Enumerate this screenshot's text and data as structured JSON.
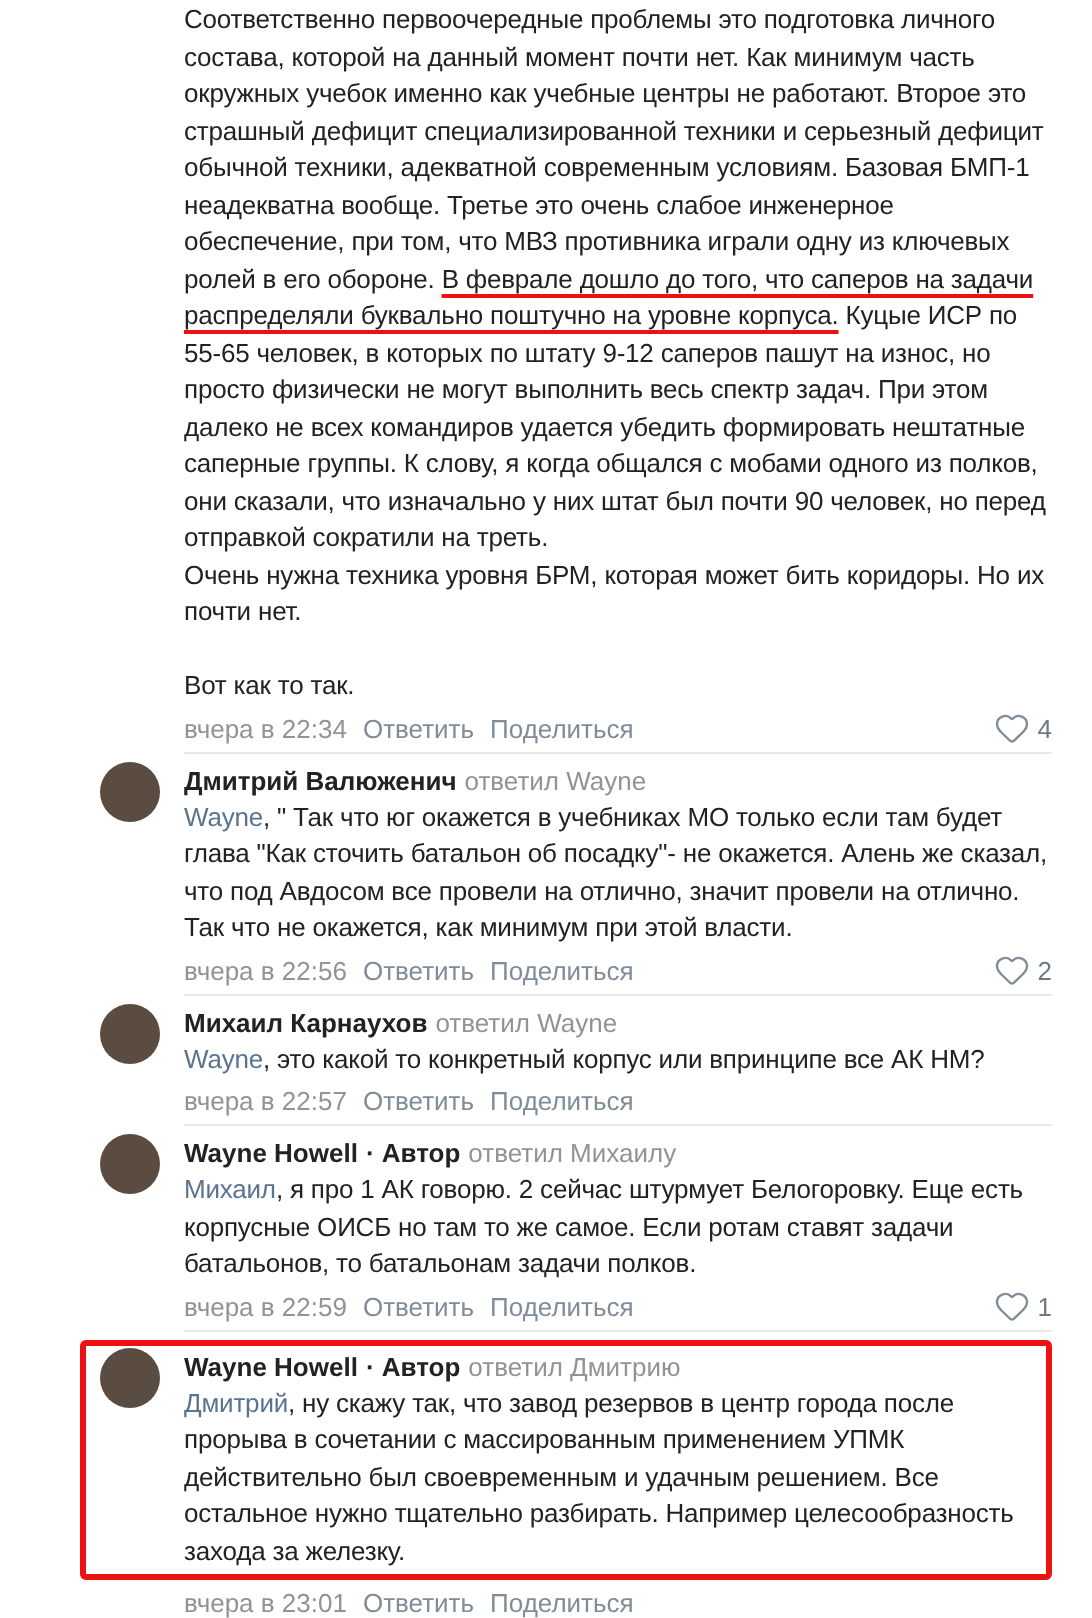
{
  "comments": [
    {
      "paragraphs": [
        {
          "segments": [
            {
              "text": "Соответственно первоочередные проблемы это подготовка личного состава, которой на данный момент почти нет. Как минимум часть окружных учебок именно как учебные центры не работают. Второе это страшный дефицит специализированной техники и серьезный дефицит обычной техники, адекватной современным условиям. Базовая БМП-1 неадекватна вообще. Третье это очень слабое инженерное обеспечение, при том, что МВЗ противника играли одну из ключевых ролей в его обороне. ",
              "underlined": false
            },
            {
              "text": "В феврале дошло до того, что саперов на задачи распределяли буквально поштучно на уровне корпуса.",
              "underlined": true
            },
            {
              "text": " Куцые ИСР по 55-65 человек, в которых по штату 9-12 саперов пашут на износ, но просто физически не могут выполнить весь спектр задач. При этом далеко не всех командиров удается убедить формировать нештатные саперные группы. К слову, я когда общался с мобами одного из полков, они сказали, что изначально у них штат был почти 90 человек, но перед отправкой сократили на треть.",
              "underlined": false
            }
          ]
        },
        {
          "segments": [
            {
              "text": "Очень нужна техника уровня БРМ, которая может бить коридоры. Но их почти нет.",
              "underlined": false
            }
          ]
        },
        {
          "segments": [
            {
              "text": "Вот как то так.",
              "underlined": false
            }
          ]
        }
      ],
      "time": "вчера в 22:34",
      "reply": "Ответить",
      "share": "Поделиться",
      "likes": "4",
      "highlighted": false
    },
    {
      "author": "Дмитрий Валюженич",
      "reply_to": "ответил Wayne",
      "paragraphs": [
        {
          "mention": "Wayne",
          "segments": [
            {
              "text": ", \" Так что юг окажется в учебниках МО только если там будет глава \"Как сточить батальон об посадку\"- не окажется. Алень же сказал, что под Авдосом все провели на отлично, значит провели на отлично. Так что не окажется, как минимум при этой власти.",
              "underlined": false
            }
          ]
        }
      ],
      "time": "вчера в 22:56",
      "reply": "Ответить",
      "share": "Поделиться",
      "likes": "2",
      "highlighted": false
    },
    {
      "author": "Михаил Карнаухов",
      "reply_to": "ответил Wayne",
      "paragraphs": [
        {
          "mention": "Wayne",
          "segments": [
            {
              "text": ", это какой то конкретный корпус или впринципе все АК НМ?",
              "underlined": false
            }
          ]
        }
      ],
      "time": "вчера в 22:57",
      "reply": "Ответить",
      "share": "Поделиться",
      "highlighted": false
    },
    {
      "author": "Wayne Howell",
      "badge": "· Автор",
      "reply_to": "ответил Михаилу",
      "paragraphs": [
        {
          "mention": "Михаил",
          "segments": [
            {
              "text": ", я про 1 АК говорю. 2 сейчас штурмует Белогоровку. Еще есть корпусные ОИСБ но там то же самое. Если ротам ставят задачи батальонов, то батальонам задачи полков.",
              "underlined": false
            }
          ]
        }
      ],
      "time": "вчера в 22:59",
      "reply": "Ответить",
      "share": "Поделиться",
      "likes": "1",
      "highlighted": false
    },
    {
      "author": "Wayne Howell",
      "badge": "· Автор",
      "reply_to": "ответил Дмитрию",
      "paragraphs": [
        {
          "mention": "Дмитрий",
          "segments": [
            {
              "text": ", ну скажу так, что завод резервов в центр города после прорыва в сочетании с массированным применением УПМК действительно был своевременным и удачным решением. Все остальное нужно тщательно разбирать. Например целесообразность захода за железку.",
              "underlined": false
            }
          ]
        }
      ],
      "time": "вчера в 23:01",
      "reply": "Ответить",
      "share": "Поделиться",
      "highlighted": true
    }
  ]
}
